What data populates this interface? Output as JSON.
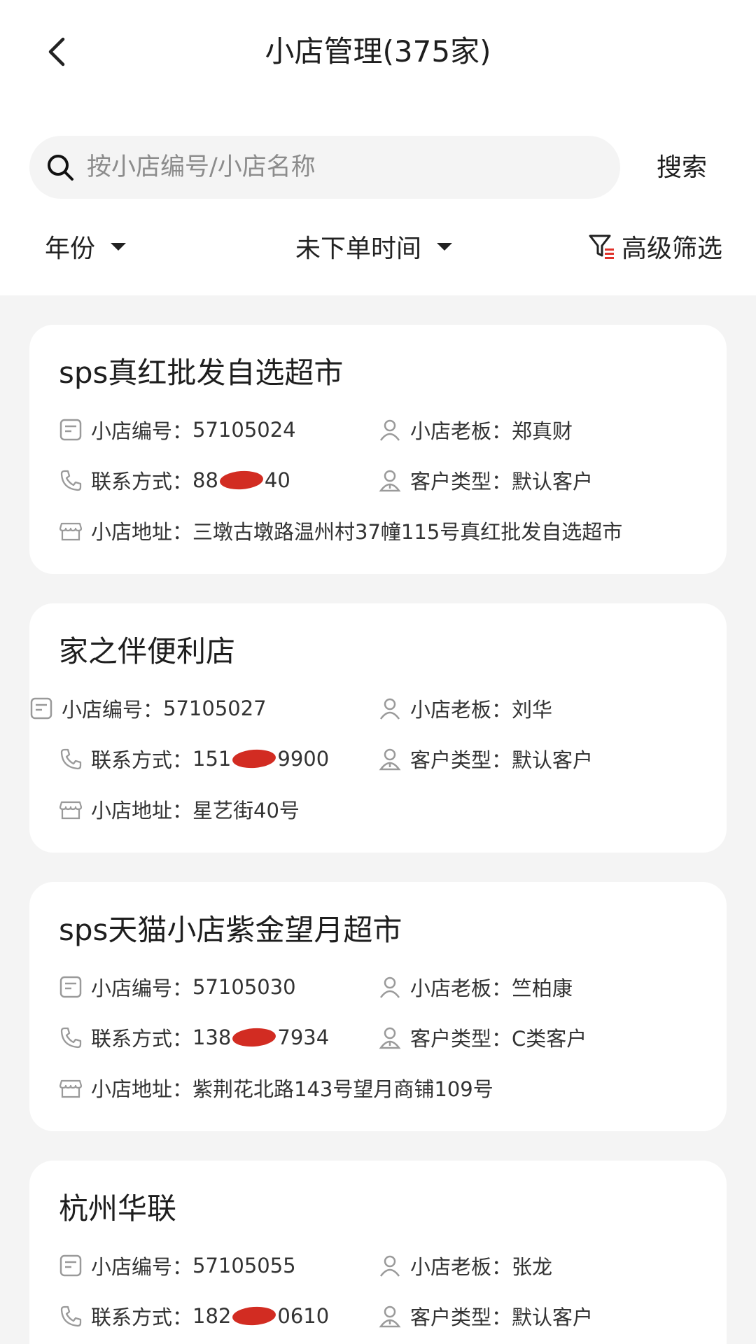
{
  "header": {
    "title": "小店管理(375家)"
  },
  "search": {
    "placeholder": "按小店编号/小店名称",
    "button": "搜索"
  },
  "filters": {
    "year": "年份",
    "no_order": "未下单时间",
    "advanced": "高级筛选"
  },
  "labels": {
    "code": "小店编号：",
    "owner": "小店老板：",
    "phone": "联系方式：",
    "type": "客户类型：",
    "address": "小店地址："
  },
  "shops": [
    {
      "name": "sps真红批发自选超市",
      "code": "57105024",
      "owner": "郑真财",
      "phone_prefix": "88",
      "phone_suffix": "40",
      "type": "默认客户",
      "address": "三墩古墩路温州村37幢115号真红批发自选超市"
    },
    {
      "name": "家之伴便利店",
      "code": "57105027",
      "owner": "刘华",
      "phone_prefix": "151",
      "phone_suffix": "9900",
      "type": "默认客户",
      "address": "星艺街40号"
    },
    {
      "name": "sps天猫小店紫金望月超市",
      "code": "57105030",
      "owner": "竺柏康",
      "phone_prefix": "138",
      "phone_suffix": "7934",
      "type": "C类客户",
      "address": "紫荆花北路143号望月商铺109号"
    },
    {
      "name": "杭州华联",
      "code": "57105055",
      "owner": "张龙",
      "phone_prefix": "182",
      "phone_suffix": "0610",
      "type": "默认客户"
    }
  ],
  "colors": {
    "mask": "#d22c22",
    "icon": "#9a9a9a",
    "filter_accent": "#e0312a"
  }
}
